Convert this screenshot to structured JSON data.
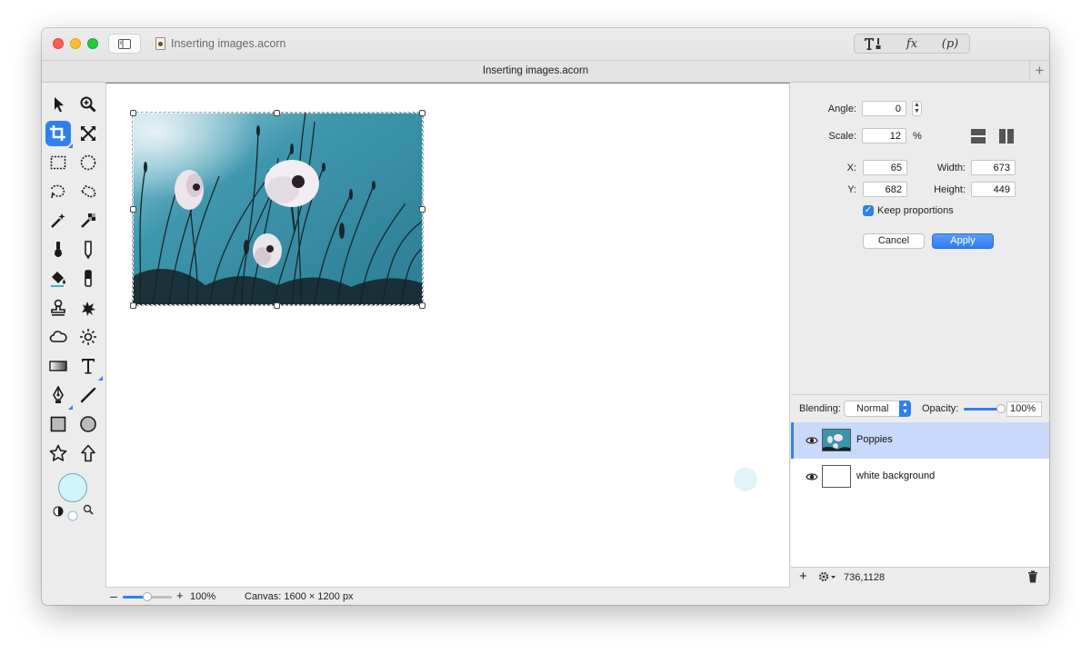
{
  "window": {
    "title": "Inserting images.acorn",
    "tab_title": "Inserting images.acorn",
    "title_icons": [
      "text-tools-icon",
      "fx-icon",
      "p-icon"
    ],
    "fx_label": "fx",
    "p_label": "(p)",
    "tab_add": "+"
  },
  "tools": [
    "select-arrow-icon",
    "zoom-icon",
    "crop-icon",
    "transform-icon",
    "rect-select-icon",
    "ellipse-select-icon",
    "lasso-icon",
    "polygon-lasso-icon",
    "magic-wand-icon",
    "color-wand-icon",
    "brush-icon",
    "pencil-icon",
    "paint-bucket-icon",
    "eraser-icon",
    "clone-stamp-icon",
    "splatter-icon",
    "cloud-icon",
    "sun-icon",
    "gradient-icon",
    "text-icon",
    "pen-icon",
    "line-icon",
    "rectangle-shape-icon",
    "oval-shape-icon",
    "star-icon",
    "arrow-up-icon"
  ],
  "active_tool": "crop-icon",
  "colors": {
    "accent": "#2f80ed",
    "fill_color": "#d2f3fb",
    "selected_layer_bg": "#c8d9fb",
    "sky": "#3d93a9"
  },
  "inspector": {
    "angle_label": "Angle:",
    "angle_value": "0",
    "scale_label": "Scale:",
    "scale_value": "12",
    "scale_unit": "%",
    "x_label": "X:",
    "x_value": "65",
    "y_label": "Y:",
    "y_value": "682",
    "width_label": "Width:",
    "width_value": "673",
    "height_label": "Height:",
    "height_value": "449",
    "keep_proportions_label": "Keep proportions",
    "keep_proportions_checked": true,
    "cancel_label": "Cancel",
    "apply_label": "Apply",
    "flip_icons": [
      "flip-vertical-icon",
      "flip-horizontal-icon"
    ]
  },
  "layers": {
    "blending_label": "Blending:",
    "blending_value": "Normal",
    "opacity_label": "Opacity:",
    "opacity_value": "100%",
    "opacity_fraction": 1.0,
    "items": [
      {
        "name": "Poppies",
        "selected": true,
        "visible": true
      },
      {
        "name": "white background",
        "selected": false,
        "visible": true
      }
    ],
    "coords": "736,1128",
    "add_label": "+"
  },
  "status": {
    "zoom_value": "100%",
    "zoom_fraction": 0.5,
    "canvas_size": "Canvas: 1600 × 1200 px",
    "zoom_minus": "–",
    "zoom_plus": "+"
  }
}
